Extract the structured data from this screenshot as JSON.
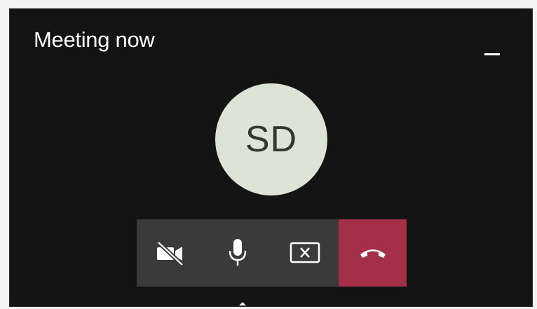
{
  "window": {
    "title": "Meeting now"
  },
  "avatar": {
    "initials": "SD"
  },
  "toolbar": {
    "buttons": [
      {
        "icon": "video-off-icon"
      },
      {
        "icon": "microphone-icon"
      },
      {
        "icon": "stop-sharing-icon"
      },
      {
        "icon": "hang-up-icon"
      }
    ]
  },
  "colors": {
    "window_bg": "#141414",
    "toolbar_bg": "#3a3a3a",
    "hangup_bg": "#a52f49",
    "avatar_bg": "#dde4d6",
    "avatar_text": "#2f3a2b"
  }
}
